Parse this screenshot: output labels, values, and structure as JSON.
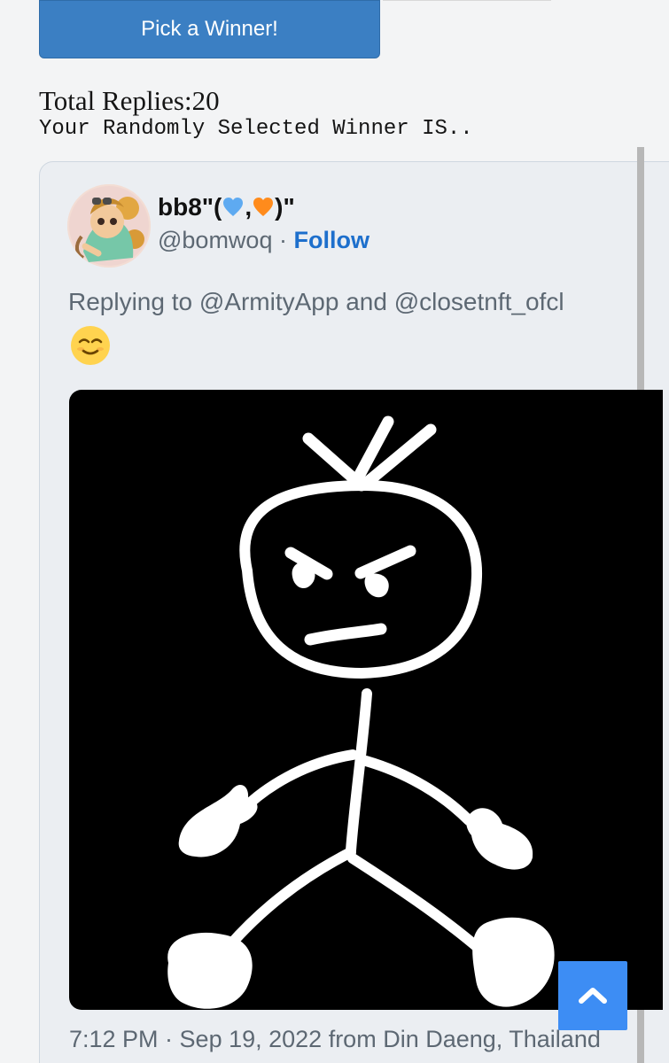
{
  "pick_button": {
    "label": "Pick a Winner!"
  },
  "summary": {
    "total_replies": "Total Replies:20",
    "winner_text": "Your Randomly Selected Winner IS.."
  },
  "tweet": {
    "display_name_prefix": "bb8\"(",
    "display_name_separator": ",",
    "display_name_suffix": ")\"",
    "handle": "@bomwoq",
    "separator": " · ",
    "follow_label": "Follow",
    "replying_to": "Replying to @ArmityApp and @closetnft_ofcl",
    "timestamp": "7:12 PM · Sep 19, 2022 from Din Daeng, Thailand",
    "emoji_icon": "relieved-face-icon",
    "heart_icons": [
      "blue-heart-icon",
      "orange-heart-icon"
    ]
  },
  "colors": {
    "button": "#3b7fc3",
    "follow": "#1d6fcc",
    "card": "#ebeef2",
    "scroll_button": "#3d8df4"
  }
}
